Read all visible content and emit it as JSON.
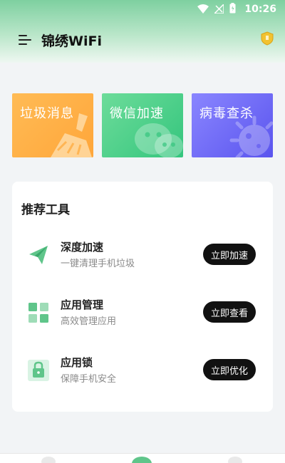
{
  "status_bar": {
    "time": "10:26"
  },
  "header": {
    "title": "锦绣WiFi"
  },
  "feature_cards": [
    {
      "label": "垃圾消息",
      "icon": "broom-icon",
      "color": "#ffa63a"
    },
    {
      "label": "微信加速",
      "icon": "wechat-icon",
      "color": "#34c57d"
    },
    {
      "label": "病毒查杀",
      "icon": "virus-icon",
      "color": "#5a54ee"
    }
  ],
  "tools_section": {
    "title": "推荐工具",
    "items": [
      {
        "name": "深度加速",
        "desc": "一键清理手机垃圾",
        "button": "立即加速",
        "icon": "paper-plane-icon"
      },
      {
        "name": "应用管理",
        "desc": "高效管理应用",
        "button": "立即查看",
        "icon": "apps-grid-icon"
      },
      {
        "name": "应用锁",
        "desc": "保障手机安全",
        "button": "立即优化",
        "icon": "lock-icon"
      }
    ]
  },
  "colors": {
    "accent_green": "#5fc58a",
    "button_black": "#111111",
    "shield_yellow": "#f2c230"
  }
}
